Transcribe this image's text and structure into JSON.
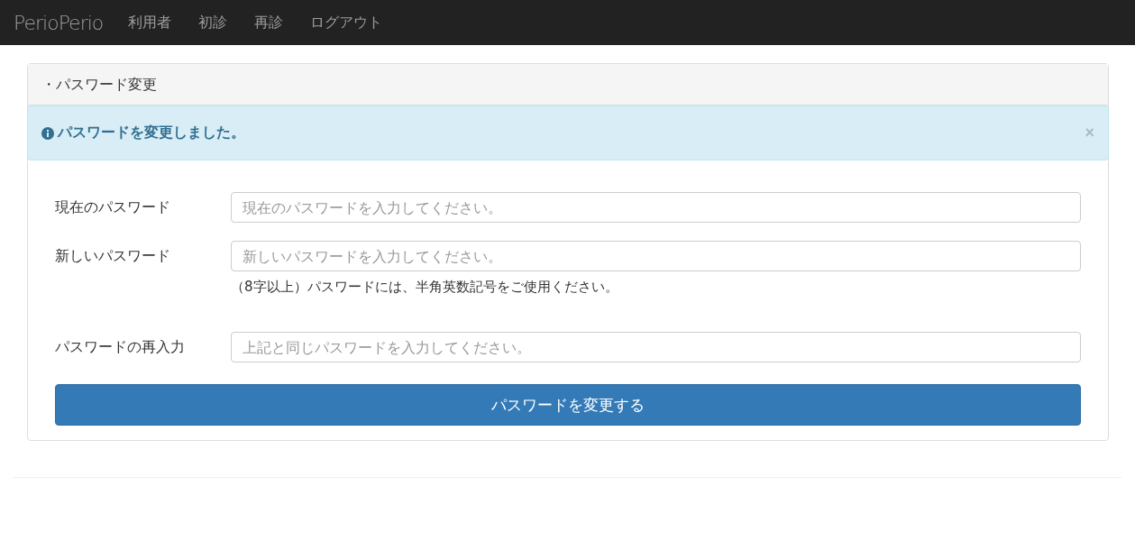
{
  "navbar": {
    "brand": "PerioPerio",
    "items": [
      "利用者",
      "初診",
      "再診",
      "ログアウト"
    ]
  },
  "panel": {
    "heading": "・パスワード変更",
    "alert": {
      "message": "パスワードを変更しました。",
      "close": "×"
    },
    "fields": [
      {
        "label": "現在のパスワード",
        "placeholder": "現在のパスワードを入力してください。"
      },
      {
        "label": "新しいパスワード",
        "placeholder": "新しいパスワードを入力してください。",
        "hint": "（8字以上）パスワードには、半角英数記号をご使用ください。"
      },
      {
        "label": "パスワードの再入力",
        "placeholder": "上記と同じパスワードを入力してください。"
      }
    ],
    "submit": "パスワードを変更する"
  }
}
